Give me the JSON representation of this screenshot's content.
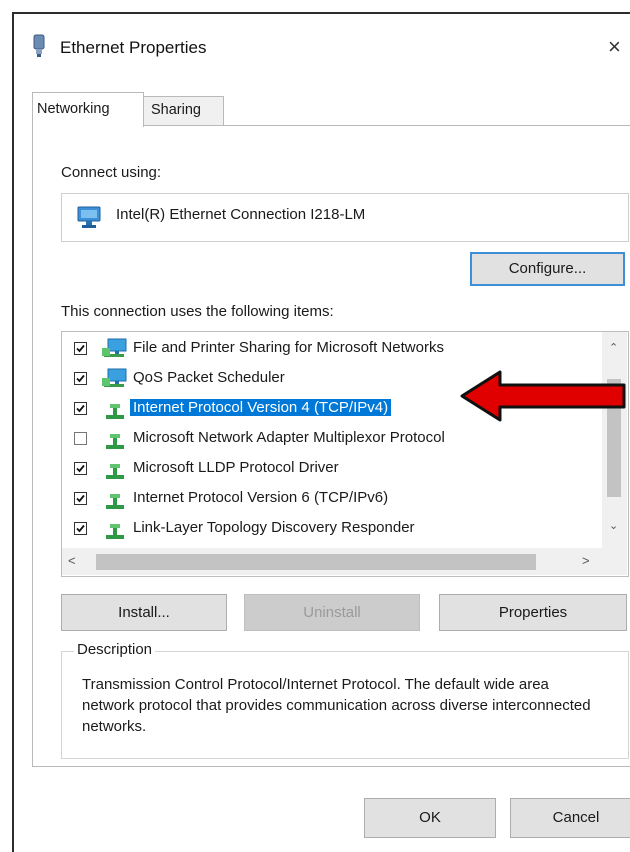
{
  "window": {
    "title": "Ethernet Properties",
    "close_glyph": "×"
  },
  "tabs": [
    {
      "label": "Networking",
      "active": true
    },
    {
      "label": "Sharing",
      "active": false
    }
  ],
  "connect_using": {
    "label": "Connect using:",
    "adapter_name": "Intel(R) Ethernet Connection I218-LM",
    "adapter_icon": "network-adapter-icon"
  },
  "buttons": {
    "configure": "Configure...",
    "install": "Install...",
    "uninstall": "Uninstall",
    "properties": "Properties",
    "ok": "OK",
    "cancel": "Cancel"
  },
  "items_label": "This connection uses the following items:",
  "items": [
    {
      "label": "File and Printer Sharing for Microsoft Networks",
      "checked": true,
      "icon": "network-service-icon",
      "selected": false
    },
    {
      "label": "QoS Packet Scheduler",
      "checked": true,
      "icon": "network-service-icon",
      "selected": false
    },
    {
      "label": "Internet Protocol Version 4 (TCP/IPv4)",
      "checked": true,
      "icon": "protocol-icon",
      "selected": true
    },
    {
      "label": "Microsoft Network Adapter Multiplexor Protocol",
      "checked": false,
      "icon": "protocol-icon",
      "selected": false
    },
    {
      "label": "Microsoft LLDP Protocol Driver",
      "checked": true,
      "icon": "protocol-icon",
      "selected": false
    },
    {
      "label": "Internet Protocol Version 6 (TCP/IPv6)",
      "checked": true,
      "icon": "protocol-icon",
      "selected": false
    },
    {
      "label": "Link-Layer Topology Discovery Responder",
      "checked": true,
      "icon": "protocol-icon",
      "selected": false
    }
  ],
  "description": {
    "legend": "Description",
    "text": "Transmission Control Protocol/Internet Protocol. The default wide area network protocol that provides communication across diverse interconnected networks."
  },
  "colors": {
    "selection": "#0078d7",
    "annotation_arrow": "#e00000",
    "focus_border": "#3f8fd8"
  }
}
